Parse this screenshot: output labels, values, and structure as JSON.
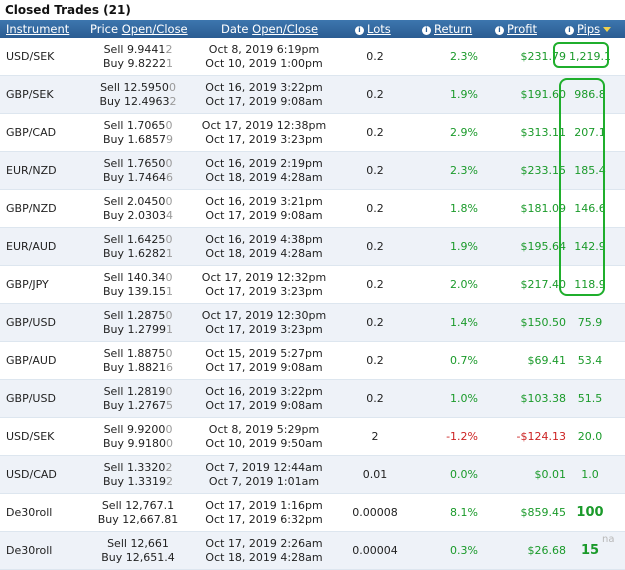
{
  "panel": {
    "title": "Closed Trades (21)"
  },
  "columns": {
    "instrument": "Instrument",
    "price_pre": "Price ",
    "price_link": "Open/Close",
    "date_pre": "Date ",
    "date_link": "Open/Close",
    "lots": "Lots",
    "return": "Return",
    "profit": "Profit",
    "pips": "Pips"
  },
  "rows": [
    {
      "instrument": "USD/SEK",
      "open_side": "Sell",
      "open_price": "9.9441",
      "open_tail": "2",
      "close_side": "Buy",
      "close_price": "9.8222",
      "close_tail": "1",
      "open_date": "Oct 8, 2019 6:19pm",
      "close_date": "Oct 10, 2019 1:00pm",
      "lots": "0.2",
      "return": "2.3%",
      "profit": "$231.79",
      "pips": "1,219.1",
      "sign": "pos"
    },
    {
      "instrument": "GBP/SEK",
      "open_side": "Sell",
      "open_price": "12.5950",
      "open_tail": "0",
      "close_side": "Buy",
      "close_price": "12.4963",
      "close_tail": "2",
      "open_date": "Oct 16, 2019 3:22pm",
      "close_date": "Oct 17, 2019 9:08am",
      "lots": "0.2",
      "return": "1.9%",
      "profit": "$191.60",
      "pips": "986.8",
      "sign": "pos"
    },
    {
      "instrument": "GBP/CAD",
      "open_side": "Sell",
      "open_price": "1.7065",
      "open_tail": "0",
      "close_side": "Buy",
      "close_price": "1.6857",
      "close_tail": "9",
      "open_date": "Oct 17, 2019 12:38pm",
      "close_date": "Oct 17, 2019 3:23pm",
      "lots": "0.2",
      "return": "2.9%",
      "profit": "$313.11",
      "pips": "207.1",
      "sign": "pos"
    },
    {
      "instrument": "EUR/NZD",
      "open_side": "Sell",
      "open_price": "1.7650",
      "open_tail": "0",
      "close_side": "Buy",
      "close_price": "1.7464",
      "close_tail": "6",
      "open_date": "Oct 16, 2019 2:19pm",
      "close_date": "Oct 18, 2019 4:28am",
      "lots": "0.2",
      "return": "2.3%",
      "profit": "$233.15",
      "pips": "185.4",
      "sign": "pos"
    },
    {
      "instrument": "GBP/NZD",
      "open_side": "Sell",
      "open_price": "2.0450",
      "open_tail": "0",
      "close_side": "Buy",
      "close_price": "2.0303",
      "close_tail": "4",
      "open_date": "Oct 16, 2019 3:21pm",
      "close_date": "Oct 17, 2019 9:08am",
      "lots": "0.2",
      "return": "1.8%",
      "profit": "$181.09",
      "pips": "146.6",
      "sign": "pos"
    },
    {
      "instrument": "EUR/AUD",
      "open_side": "Sell",
      "open_price": "1.6425",
      "open_tail": "0",
      "close_side": "Buy",
      "close_price": "1.6282",
      "close_tail": "1",
      "open_date": "Oct 16, 2019 4:38pm",
      "close_date": "Oct 18, 2019 4:28am",
      "lots": "0.2",
      "return": "1.9%",
      "profit": "$195.64",
      "pips": "142.9",
      "sign": "pos"
    },
    {
      "instrument": "GBP/JPY",
      "open_side": "Sell",
      "open_price": "140.34",
      "open_tail": "0",
      "close_side": "Buy",
      "close_price": "139.15",
      "close_tail": "1",
      "open_date": "Oct 17, 2019 12:32pm",
      "close_date": "Oct 17, 2019 3:23pm",
      "lots": "0.2",
      "return": "2.0%",
      "profit": "$217.40",
      "pips": "118.9",
      "sign": "pos"
    },
    {
      "instrument": "GBP/USD",
      "open_side": "Sell",
      "open_price": "1.2875",
      "open_tail": "0",
      "close_side": "Buy",
      "close_price": "1.2799",
      "close_tail": "1",
      "open_date": "Oct 17, 2019 12:30pm",
      "close_date": "Oct 17, 2019 3:23pm",
      "lots": "0.2",
      "return": "1.4%",
      "profit": "$150.50",
      "pips": "75.9",
      "sign": "pos"
    },
    {
      "instrument": "GBP/AUD",
      "open_side": "Sell",
      "open_price": "1.8875",
      "open_tail": "0",
      "close_side": "Buy",
      "close_price": "1.8821",
      "close_tail": "6",
      "open_date": "Oct 15, 2019 5:27pm",
      "close_date": "Oct 17, 2019 9:08am",
      "lots": "0.2",
      "return": "0.7%",
      "profit": "$69.41",
      "pips": "53.4",
      "sign": "pos"
    },
    {
      "instrument": "GBP/USD",
      "open_side": "Sell",
      "open_price": "1.2819",
      "open_tail": "0",
      "close_side": "Buy",
      "close_price": "1.2767",
      "close_tail": "5",
      "open_date": "Oct 16, 2019 3:22pm",
      "close_date": "Oct 17, 2019 9:08am",
      "lots": "0.2",
      "return": "1.0%",
      "profit": "$103.38",
      "pips": "51.5",
      "sign": "pos"
    },
    {
      "instrument": "USD/SEK",
      "open_side": "Sell",
      "open_price": "9.9200",
      "open_tail": "0",
      "close_side": "Buy",
      "close_price": "9.9180",
      "close_tail": "0",
      "open_date": "Oct 8, 2019 5:29pm",
      "close_date": "Oct 10, 2019 9:50am",
      "lots": "2",
      "return": "-1.2%",
      "profit": "-$124.13",
      "pips": "20.0",
      "sign": "neg"
    },
    {
      "instrument": "USD/CAD",
      "open_side": "Sell",
      "open_price": "1.3320",
      "open_tail": "2",
      "close_side": "Buy",
      "close_price": "1.3319",
      "close_tail": "2",
      "open_date": "Oct 7, 2019 12:44am",
      "close_date": "Oct 7, 2019 1:01am",
      "lots": "0.01",
      "return": "0.0%",
      "profit": "$0.01",
      "pips": "1.0",
      "sign": "pos"
    },
    {
      "instrument": "De30roll",
      "open_side": "Sell",
      "open_price": "12,767.1",
      "open_tail": "",
      "close_side": "Buy",
      "close_price": "12,667.81",
      "close_tail": "",
      "open_date": "Oct 17, 2019 1:16pm",
      "close_date": "Oct 17, 2019 6:32pm",
      "lots": "0.00008",
      "return": "8.1%",
      "profit": "$859.45",
      "pips": "100",
      "sign": "pos",
      "pips_hand": true
    },
    {
      "instrument": "De30roll",
      "open_side": "Sell",
      "open_price": "12,661",
      "open_tail": "",
      "close_side": "Buy",
      "close_price": "12,651.4",
      "close_tail": "",
      "open_date": "Oct 17, 2019 2:26am",
      "close_date": "Oct 18, 2019 4:28am",
      "lots": "0.00004",
      "return": "0.3%",
      "profit": "$26.68",
      "pips": "15",
      "sign": "pos",
      "pips_hand": true
    }
  ],
  "watermark": "na",
  "colors": {
    "header_bg": "#2b5c92",
    "positive": "#1a9a2a",
    "negative": "#cc2222",
    "annotation": "#1fae2c"
  }
}
